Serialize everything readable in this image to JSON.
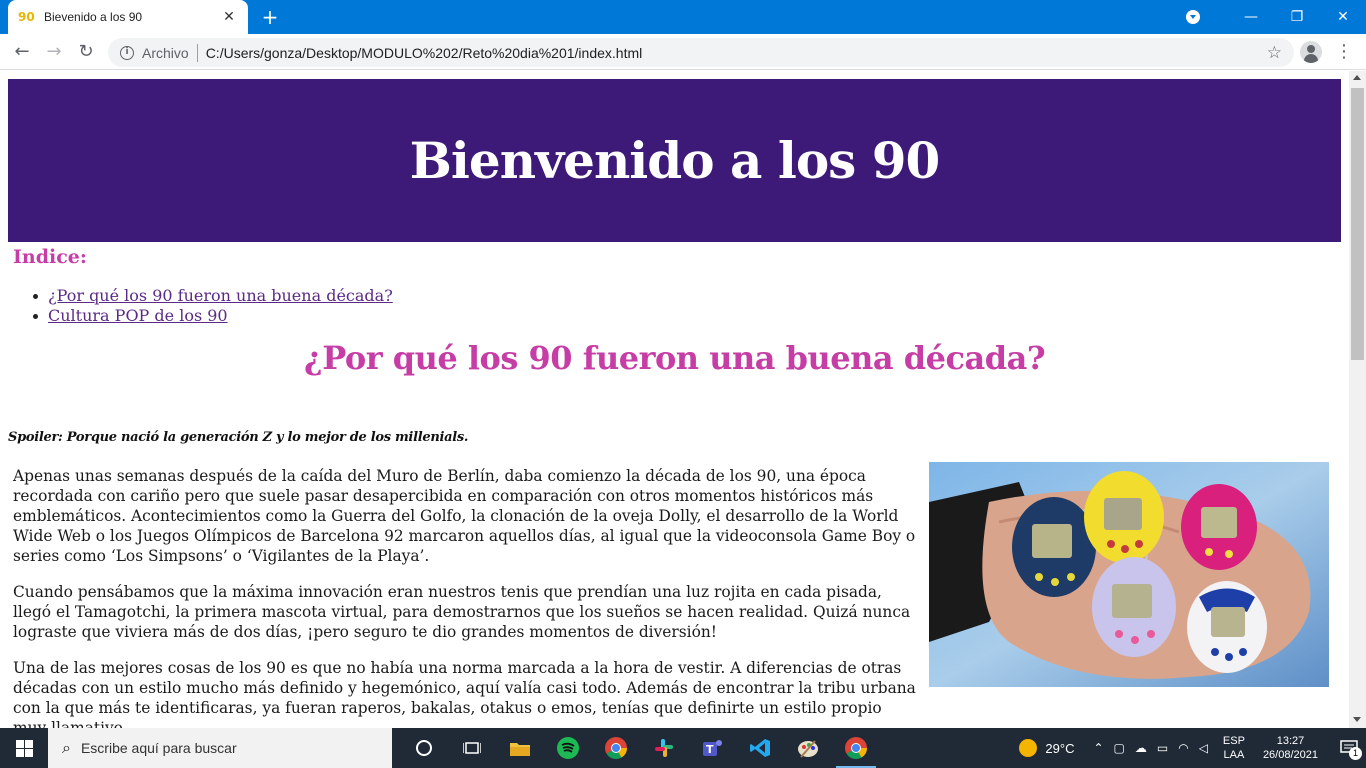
{
  "browser": {
    "tab_title": "Bievenido a los 90",
    "tab_favicon": "90",
    "scheme_label": "Archivo",
    "url": "C:/Users/gonza/Desktop/MODULO%202/Reto%20dia%201/index.html"
  },
  "page": {
    "hero_title": "Bienvenido a los 90",
    "index_heading": "Indice:",
    "toc": [
      "¿Por qué los 90 fueron una buena década?",
      "Cultura POP de los 90"
    ],
    "section_title": "¿Por qué los 90 fueron una buena década?",
    "spoiler": "Spoiler: Porque nació la generación Z y lo mejor de los millenials.",
    "paragraphs": [
      "Apenas unas semanas después de la caída del Muro de Berlín, daba comienzo la década de los 90, una época recordada con cariño pero que suele pasar desapercibida en comparación con otros momentos históricos más emblemáticos. Acontecimientos como la Guerra del Golfo, la clonación de la oveja Dolly, el desarrollo de la World Wide Web o los Juegos Olímpicos de Barcelona 92 marcaron aquellos días, al igual que la videoconsola Game Boy o series como ‘Los Simpsons’ o ‘Vigilantes de la Playa’.",
      "Cuando pensábamos que la máxima innovación eran nuestros tenis que prendían una luz rojita en cada pisada, llegó el Tamagotchi, la primera mascota virtual, para demostrarnos que los sueños se hacen realidad. Quizá nunca lograste que viviera más de dos días, ¡pero seguro te dio grandes momentos de diversión!",
      "Una de las mejores cosas de los 90 es que no había una norma marcada a la hora de vestir. A diferencias de otras décadas con un estilo mucho más definido y hegemónico, aquí valía casi todo. Además de encontrar la tribu urbana con la que más te identificaras, ya fueran raperos, bakalas, otakus o emos, tenías que definirte un estilo propio muy llamativo."
    ]
  },
  "taskbar": {
    "search_placeholder": "Escribe aquí para buscar",
    "temperature": "29°C",
    "lang_top": "ESP",
    "lang_bottom": "LAA",
    "time": "13:27",
    "date": "26/08/2021",
    "notification_count": "1"
  },
  "colors": {
    "hero_bg": "#3d1a78",
    "accent_pink": "#c63da6",
    "link_purple": "#5b2a86",
    "titlebar_blue": "#0078d7"
  }
}
